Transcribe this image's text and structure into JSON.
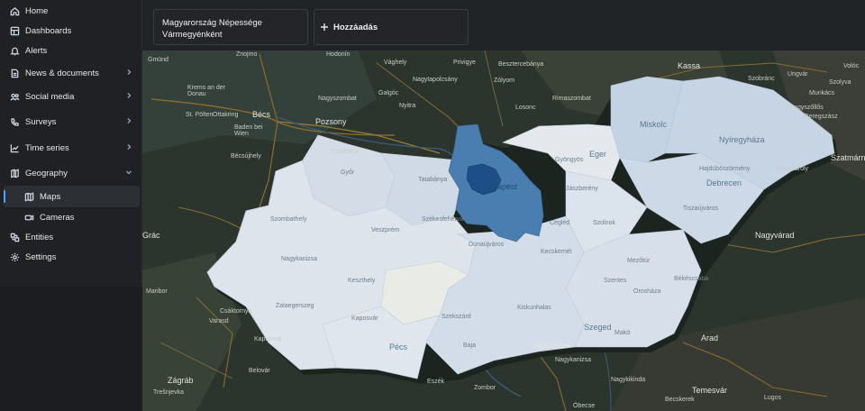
{
  "sidebar": {
    "items": [
      {
        "label": "Home",
        "icon": "home-icon"
      },
      {
        "label": "Dashboards",
        "icon": "dashboard-icon"
      },
      {
        "label": "Alerts",
        "icon": "bell-icon"
      },
      {
        "label": "News & documents",
        "icon": "document-icon"
      },
      {
        "label": "Social media",
        "icon": "people-icon"
      },
      {
        "label": "Surveys",
        "icon": "phone-icon"
      },
      {
        "label": "Time series",
        "icon": "chart-line-icon"
      },
      {
        "label": "Geography",
        "icon": "globe-icon"
      },
      {
        "label": "Maps",
        "icon": "map-icon"
      },
      {
        "label": "Cameras",
        "icon": "camera-icon"
      },
      {
        "label": "Entities",
        "icon": "entities-icon"
      },
      {
        "label": "Settings",
        "icon": "gear-icon"
      }
    ]
  },
  "toolbar": {
    "map_title_line1": "Magyarország Népessége",
    "map_title_line2": "Vármegyénként",
    "add_label": "Hozzáadás"
  },
  "map": {
    "labels_outside": [
      "Gmünd",
      "Znojmo",
      "Hodonín",
      "Vághely",
      "Privigye",
      "Besztercebánya",
      "Kassa",
      "Volóc",
      "Krems an der Donau",
      "Bécs",
      "Pozsony",
      "Nagyszombat",
      "Galgóc",
      "Nagytapolcsány",
      "Zólyom",
      "Ungvár",
      "Szobránc",
      "Nyitra",
      "Rimaszombat",
      "Losonc",
      "Munkács",
      "Szolyva",
      "St. Pölten",
      "Ottakring",
      "Baden bei Wien",
      "Bécsújhely",
      "Csallóköz",
      "Beregszász",
      "Nagyszőllős",
      "Szatmárnémeti",
      "Nagykároly",
      "Nagyvárad",
      "Grác",
      "Maribor",
      "Varasd",
      "Csáktornya",
      "Kapronca",
      "Belovár",
      "Zágráb",
      "Eszék",
      "Zombor",
      "Szabadka",
      "Arad",
      "Temesvár",
      "Lugos",
      "Nagykikinda",
      "Nagykanizsa",
      "Becskerek",
      "Óbecse",
      "Trešnjevka",
      "Kassa"
    ],
    "labels_inside": [
      "Miskolc",
      "Nyíregyháza",
      "Debrecen",
      "Hajdúböszörmény",
      "Gyöngyös",
      "Eger",
      "Jászberény",
      "Cegléd",
      "Szolnok",
      "Kecskemét",
      "Szentes",
      "Orosháza",
      "Békéscsaba",
      "Szeged",
      "Makó",
      "Kiskunhalas",
      "Baja",
      "Szekszárd",
      "Pécs",
      "Kaposvár",
      "Dunaújváros",
      "Székesfehérvár",
      "Veszprém",
      "Tatabánya",
      "Győr",
      "Szombathely",
      "Zalaegerszeg",
      "Nagykanizsa",
      "Keszthely",
      "Budapest",
      "Tiszaújváros",
      "Mezőtúr"
    ],
    "county_colors": {
      "budapest": "#1d4f86",
      "pest": "#4a7db0",
      "default_light": "#dde4ec",
      "mid": "#bfd1e2",
      "pale": "#e8ebef"
    }
  }
}
